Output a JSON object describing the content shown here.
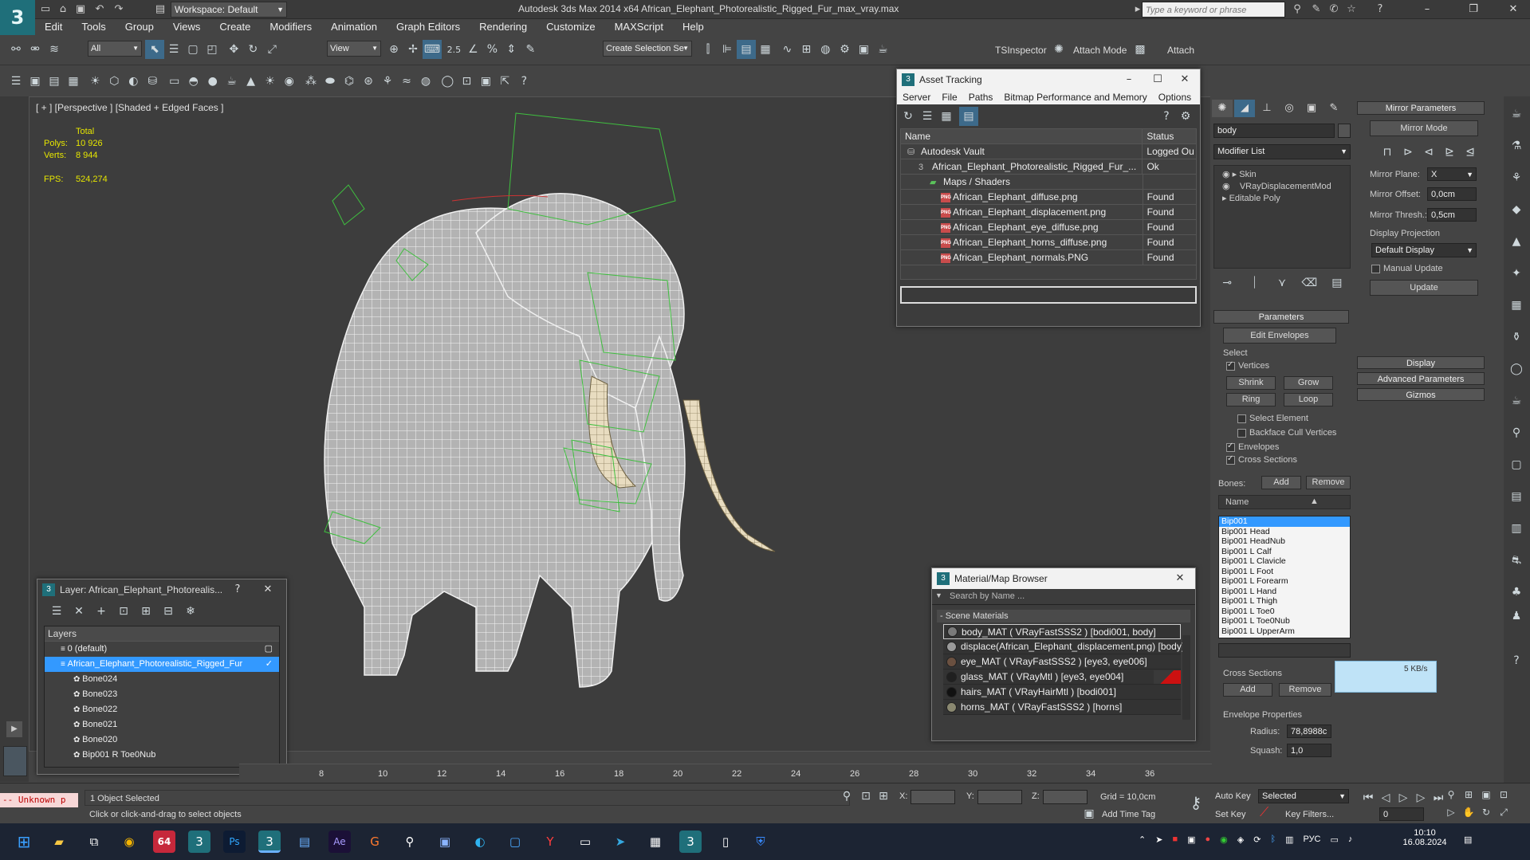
{
  "titlebar": {
    "logo": "3",
    "workspace_label": "Workspace: Default",
    "title": "Autodesk 3ds Max  2014 x64     African_Elephant_Photorealistic_Rigged_Fur_max_vray.max",
    "search_placeholder": "Type a keyword or phrase"
  },
  "menu": [
    "Edit",
    "Tools",
    "Group",
    "Views",
    "Create",
    "Modifiers",
    "Animation",
    "Graph Editors",
    "Rendering",
    "Customize",
    "MAXScript",
    "Help"
  ],
  "toolbar1": {
    "selection_filter": "All",
    "ref_coord": "View",
    "named_selection": "Create Selection Se",
    "snap_label": "2.5",
    "tsinspector": "TSInspector",
    "attach_mode": "Attach Mode",
    "attach": "Attach"
  },
  "viewport": {
    "label": "[ + ] [Perspective ] [Shaded + Edged Faces ]",
    "stats_header": "Total",
    "polys_label": "Polys:",
    "polys": "10 926",
    "verts_label": "Verts:",
    "verts": "8 944",
    "fps_label": "FPS:",
    "fps": "524,274"
  },
  "asset_tracking": {
    "title": "Asset Tracking",
    "menu": [
      "Server",
      "File",
      "Paths",
      "Bitmap Performance and Memory",
      "Options"
    ],
    "col_name": "Name",
    "col_status": "Status",
    "rows": [
      {
        "name": "Autodesk Vault",
        "status": "Logged Ou",
        "indent": 0,
        "icon": "vault"
      },
      {
        "name": "African_Elephant_Photorealistic_Rigged_Fur_...",
        "status": "Ok",
        "indent": 1,
        "icon": "max"
      },
      {
        "name": "Maps / Shaders",
        "status": "",
        "indent": 2,
        "icon": "folder"
      },
      {
        "name": "African_Elephant_diffuse.png",
        "status": "Found",
        "indent": 3,
        "icon": "png"
      },
      {
        "name": "African_Elephant_displacement.png",
        "status": "Found",
        "indent": 3,
        "icon": "png"
      },
      {
        "name": "African_Elephant_eye_diffuse.png",
        "status": "Found",
        "indent": 3,
        "icon": "png"
      },
      {
        "name": "African_Elephant_horns_diffuse.png",
        "status": "Found",
        "indent": 3,
        "icon": "png"
      },
      {
        "name": "African_Elephant_normals.PNG",
        "status": "Found",
        "indent": 3,
        "icon": "png"
      }
    ]
  },
  "material_browser": {
    "title": "Material/Map Browser",
    "search_placeholder": "Search by Name ...",
    "group": "- Scene Materials",
    "items": [
      {
        "label": "body_MAT  ( VRayFastSSS2 )  [bodi001, body]",
        "color": "#7a7a7a"
      },
      {
        "label": "displace(African_Elephant_displacement.png) [body]",
        "color": "#9a9a9a"
      },
      {
        "label": "eye_MAT  ( VRayFastSSS2 )  [eye3, eye006]",
        "color": "#6a5040"
      },
      {
        "label": "glass_MAT  ( VRayMtl )  [eye3, eye004]",
        "color": "#202020"
      },
      {
        "label": "hairs_MAT  ( VRayHairMtl )  [bodi001]",
        "color": "#111111"
      },
      {
        "label": "horns_MAT  ( VRayFastSSS2 )  [horns]",
        "color": "#8a8870"
      }
    ]
  },
  "layer_window": {
    "title": "Layer: African_Elephant_Photorealis...",
    "help": "?",
    "col_layers": "Layers",
    "rows": [
      {
        "name": "0 (default)",
        "indent": 0,
        "selected": false
      },
      {
        "name": "African_Elephant_Photorealistic_Rigged_Fur",
        "indent": 0,
        "selected": true
      },
      {
        "name": "Bone024",
        "indent": 1,
        "selected": false
      },
      {
        "name": "Bone023",
        "indent": 1,
        "selected": false
      },
      {
        "name": "Bone022",
        "indent": 1,
        "selected": false
      },
      {
        "name": "Bone021",
        "indent": 1,
        "selected": false
      },
      {
        "name": "Bone020",
        "indent": 1,
        "selected": false
      },
      {
        "name": "Bip001 R Toe0Nub",
        "indent": 1,
        "selected": false
      }
    ]
  },
  "command_panel": {
    "object_name": "body",
    "modifier_list": "Modifier List",
    "stack": [
      "Skin",
      "VRayDisplacementMod",
      "Editable Poly"
    ],
    "parameters": "Parameters",
    "edit_envelopes": "Edit Envelopes",
    "select_group": "Select",
    "vertices": "Vertices",
    "shrink": "Shrink",
    "grow": "Grow",
    "ring": "Ring",
    "loop": "Loop",
    "select_element": "Select Element",
    "backface_cull": "Backface Cull Vertices",
    "envelopes": "Envelopes",
    "cross_sections": "Cross Sections",
    "bones_label": "Bones:",
    "add": "Add",
    "remove": "Remove",
    "bones_col": "Name",
    "bones": [
      "Bip001",
      "Bip001 Head",
      "Bip001 HeadNub",
      "Bip001 L Calf",
      "Bip001 L Clavicle",
      "Bip001 L Foot",
      "Bip001 L Forearm",
      "Bip001 L Hand",
      "Bip001 L Thigh",
      "Bip001 L Toe0",
      "Bip001 L Toe0Nub",
      "Bip001 L UpperArm"
    ],
    "cross_sections_group": "Cross Sections",
    "cs_add": "Add",
    "cs_remove": "Remove",
    "envelope_props": "Envelope Properties",
    "radius_label": "Radius:",
    "radius": "78,8988c",
    "squash_label": "Squash:",
    "squash": "1,0",
    "mirror_params": "Mirror Parameters",
    "mirror_mode": "Mirror Mode",
    "mirror_plane_label": "Mirror Plane:",
    "mirror_plane": "X",
    "mirror_offset_label": "Mirror Offset:",
    "mirror_offset": "0,0cm",
    "mirror_thresh_label": "Mirror Thresh.:",
    "mirror_thresh": "0,5cm",
    "display_projection": "Display Projection",
    "default_display": "Default Display",
    "manual_update": "Manual Update",
    "update": "Update",
    "display": "Display",
    "advanced_params": "Advanced Parameters",
    "gizmos": "Gizmos",
    "net_speed": "5 KB/s"
  },
  "timeline": {
    "ticks": [
      "8",
      "10",
      "12",
      "14",
      "16",
      "18",
      "20",
      "22",
      "24",
      "26",
      "28",
      "30",
      "32",
      "34",
      "36"
    ]
  },
  "status": {
    "maxscript": "-- Unknown p",
    "selected": "1 Object Selected",
    "prompt": "Click or click-and-drag to select objects",
    "x_label": "X:",
    "y_label": "Y:",
    "z_label": "Z:",
    "grid": "Grid = 10,0cm",
    "add_time_tag": "Add Time Tag",
    "auto_key": "Auto Key",
    "set_key": "Set Key",
    "key_mode": "Selected",
    "key_filters": "Key Filters...",
    "frame": "0"
  },
  "taskbar": {
    "lang": "РУС",
    "time": "10:10",
    "date": "16.08.2024",
    "badge_64": "64"
  }
}
